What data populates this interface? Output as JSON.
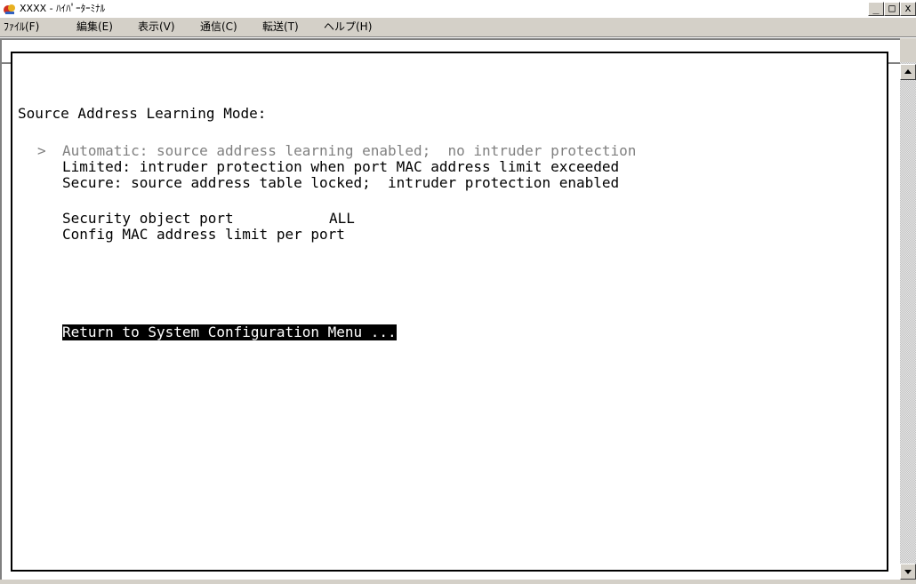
{
  "window": {
    "title": "XXXX - ﾊｲﾊﾟｰﾀｰﾐﾅﾙ",
    "minimize": "_",
    "maximize": "□",
    "close": "x"
  },
  "menu": {
    "items": [
      {
        "label": "ﾌｧｲﾙ(F)"
      },
      {
        "label": "編集(E)"
      },
      {
        "label": "表示(V)"
      },
      {
        "label": "通信(C)"
      },
      {
        "label": "転送(T)"
      },
      {
        "label": "ヘルプ(H)"
      }
    ]
  },
  "terminal": {
    "heading": "Source Address Learning Mode:",
    "options": [
      {
        "marker": ">",
        "text": "Automatic: source address learning enabled;  no intruder protection",
        "state": "dim"
      },
      {
        "marker": " ",
        "text": "Limited: intruder protection when port MAC address limit exceeded",
        "state": "normal"
      },
      {
        "marker": " ",
        "text": "Secure: source address table locked;  intruder protection enabled",
        "state": "normal"
      }
    ],
    "settings": [
      {
        "label": "Security object port",
        "value": "ALL"
      },
      {
        "label": "Config MAC address limit per port",
        "value": ""
      }
    ],
    "return_item": "Return to System Configuration Menu ..."
  },
  "colors": {
    "terminal_bg": "#ffffff",
    "terminal_fg": "#000000",
    "dim_fg": "#808080",
    "chrome": "#d4d0c8"
  }
}
